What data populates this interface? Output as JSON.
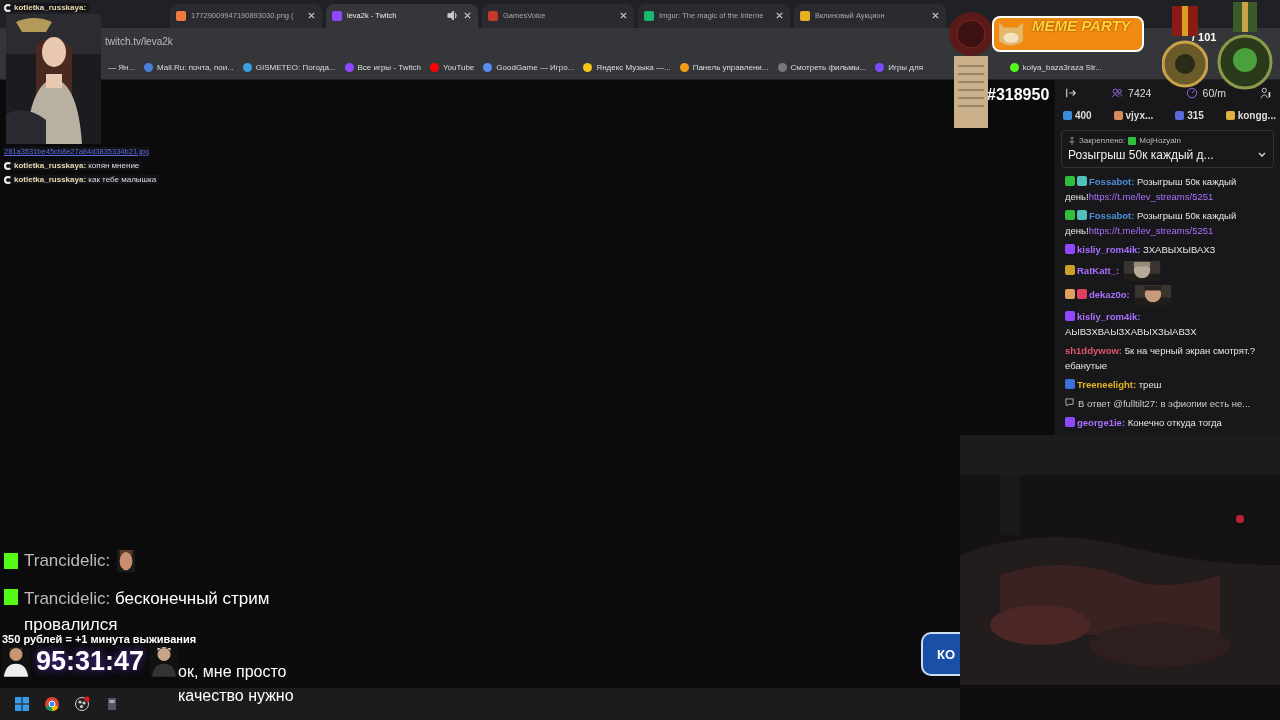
{
  "tabs": [
    {
      "title": "17729009947190893030.png (",
      "selected": false,
      "audio": false,
      "color": "#f07b3f"
    },
    {
      "title": "leva2k - Twitch",
      "selected": true,
      "audio": true,
      "color": "#9146ff"
    },
    {
      "title": "GamesVoice",
      "selected": false,
      "audio": false,
      "color": "#c0392b"
    },
    {
      "title": "Imgur: The magic of the Interne",
      "selected": false,
      "audio": false,
      "color": "#1bb76e"
    },
    {
      "title": "Вклиновый Аукцион",
      "selected": false,
      "audio": false,
      "color": "#e8b020"
    }
  ],
  "address": "twitch.tv/leva2k",
  "bookmarks": [
    {
      "label": "— Ян..."
    },
    {
      "label": "Mail.Ru: почта, пои...",
      "color": "#4a7fd9"
    },
    {
      "label": "GISMETEO: Погода...",
      "color": "#3aa0e0"
    },
    {
      "label": "Все игры - Twitch",
      "color": "#9146ff"
    },
    {
      "label": "YouTube",
      "color": "#ff0000"
    },
    {
      "label": "GoodGame — Игро...",
      "color": "#5b8def"
    },
    {
      "label": "Яндекс Музыка —...",
      "color": "#f5c518"
    },
    {
      "label": "Панель управлени...",
      "color": "#f39c12"
    },
    {
      "label": "Смотреть фильмы...",
      "color": "#777777"
    },
    {
      "label": "Игры для",
      "color": "#7c4dff"
    },
    {
      "label": "kolya_baza3raza Str...",
      "color": "#53fc18"
    }
  ],
  "left_overlay": {
    "user": "kotletka_russkaya:",
    "link": "281a3531be45cb8e27a84d3835334b21.jpg",
    "messages": [
      {
        "user": "kotletka_russkaya:",
        "text": "копян мнение"
      },
      {
        "user": "kotletka_russkaya:",
        "text": "как тебе малышка"
      }
    ]
  },
  "counter": "#318950",
  "meme_party": {
    "title": "MEME PARTY",
    "count": "/ 101"
  },
  "chat": {
    "viewers": "7424",
    "rate": "60/m",
    "gifts": [
      {
        "label": "400",
        "color": "#3a8fd9"
      },
      {
        "label": "vjyx...",
        "color": "#d98a5a"
      },
      {
        "label": "315",
        "color": "#5a6ad9"
      },
      {
        "label": "kongg...",
        "color": "#e0b040"
      }
    ],
    "pinned": {
      "label": "Закреплено:",
      "user": "MojHozyain",
      "text": "Розыгрыш 50к каждый д..."
    },
    "messages": [
      {
        "kind": "text",
        "user": {
          "name": "Fossabot:",
          "color": "#4a90d9"
        },
        "badges": [
          {
            "color": "#2fbf3a"
          },
          {
            "color": "#4fc2bc"
          }
        ],
        "text": "Розыгрыш 50к каждый день!",
        "link": "https://t.me/lev_streams/5251"
      },
      {
        "kind": "text",
        "user": {
          "name": "Fossabot:",
          "color": "#4a90d9"
        },
        "badges": [
          {
            "color": "#2fbf3a"
          },
          {
            "color": "#4fc2bc"
          }
        ],
        "text": "Розыгрыш 50к каждый день!",
        "link": "https://t.me/lev_streams/5251"
      },
      {
        "kind": "text",
        "user": {
          "name": "kisliy_rom4ik:",
          "color": "#a970ff"
        },
        "badges": [
          {
            "color": "#9146ff"
          }
        ],
        "text": "ЗХАВЫХЫВАХЗ"
      },
      {
        "kind": "emote",
        "user": {
          "name": "RatKatt_:",
          "color": "#a970ff"
        },
        "badges": [
          {
            "color": "#c9a227"
          }
        ]
      },
      {
        "kind": "emote",
        "user": {
          "name": "dekaz0o:",
          "color": "#a970ff"
        },
        "badges": [
          {
            "color": "#e0a060"
          },
          {
            "color": "#e04060"
          }
        ]
      },
      {
        "kind": "text",
        "user": {
          "name": "kisliy_rom4ik:",
          "color": "#a970ff"
        },
        "badges": [
          {
            "color": "#9146ff"
          }
        ],
        "text": "АЫВЗХВАЫЗХАВЫХЗЫАВЗХ"
      },
      {
        "kind": "text",
        "user": {
          "name": "sh1ddywow:",
          "color": "#e0566e"
        },
        "text": "5к на черный экран смотрят.? ебанутые"
      },
      {
        "kind": "text",
        "user": {
          "name": "Treeneelight:",
          "color": "#e6b422"
        },
        "badges": [
          {
            "color": "#3b6fd9"
          }
        ],
        "text": "треш"
      },
      {
        "kind": "reply",
        "text": "В ответ @fulltilt27: в эфиопии есть не..."
      },
      {
        "kind": "text",
        "user": {
          "name": "george1ie:",
          "color": "#a970ff"
        },
        "badges": [
          {
            "color": "#9146ff"
          }
        ],
        "text": "Конечно откуда тогда"
      }
    ]
  },
  "stream_chat": [
    {
      "kind": "emote",
      "user": "Trancidelic:"
    },
    {
      "kind": "text",
      "user": "Trancidelic:",
      "text": "бесконечный стрим провалился"
    }
  ],
  "timer": {
    "caption": "350 рублей = +1 минута выживания",
    "time": "95:31:47",
    "message": "ок, мне просто качество нужно"
  },
  "side_button": "КО"
}
